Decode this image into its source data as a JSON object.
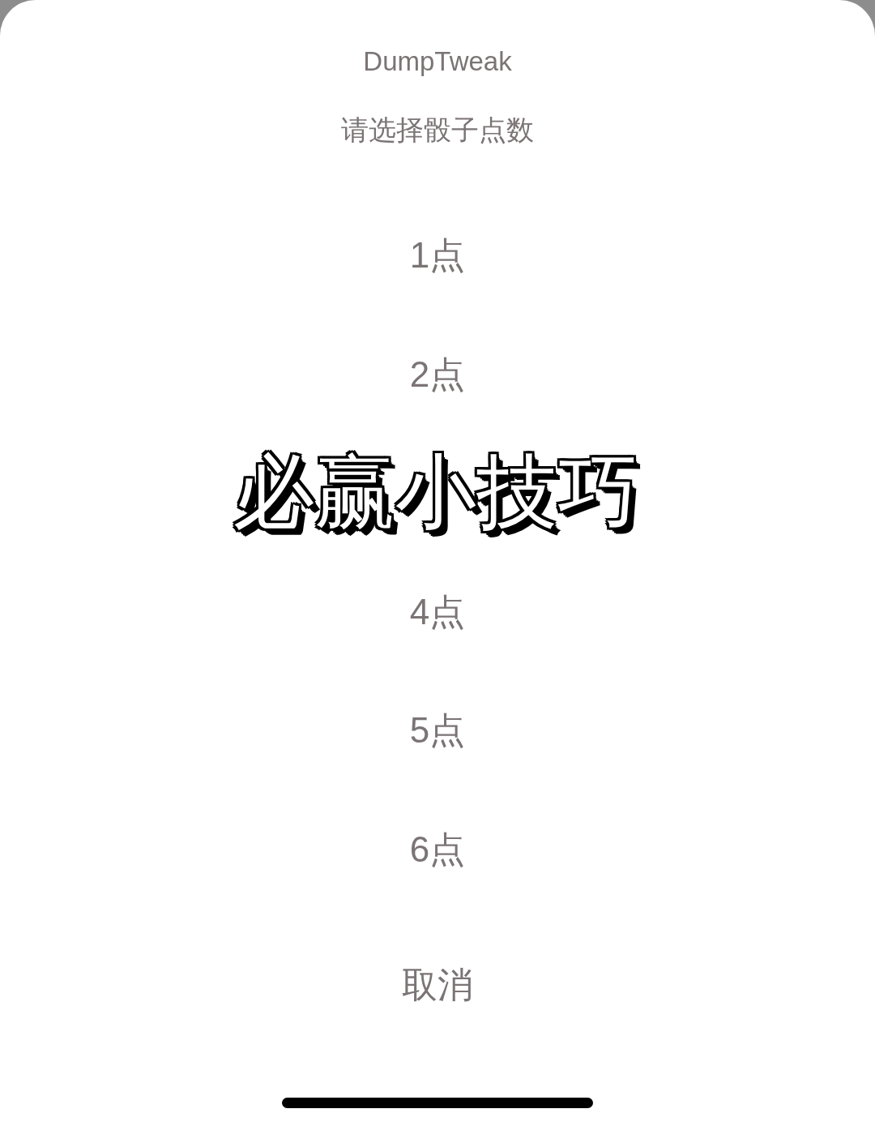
{
  "sheet": {
    "title": "DumpTweak",
    "message": "请选择骰子点数"
  },
  "rows": [
    {
      "kind": "option",
      "label": "1点"
    },
    {
      "kind": "option",
      "label": "2点"
    },
    {
      "kind": "caption",
      "label": "必赢小技巧"
    },
    {
      "kind": "option",
      "label": "4点"
    },
    {
      "kind": "option",
      "label": "5点"
    },
    {
      "kind": "option",
      "label": "6点"
    }
  ],
  "cancel": {
    "label": "取消"
  }
}
